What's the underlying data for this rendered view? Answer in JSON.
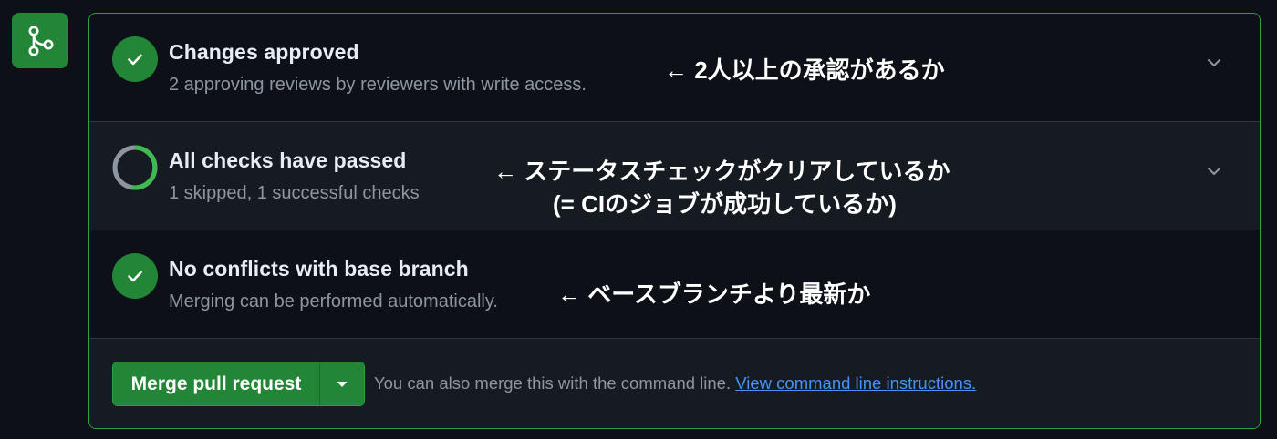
{
  "colors": {
    "background": "#0d1117",
    "success_green": "#238636",
    "border_green": "#2ea043",
    "link_blue": "#4493f8",
    "muted_text": "#8d96a0"
  },
  "merge_icon": {
    "icon": "git-merge-icon"
  },
  "sections": [
    {
      "title": "Changes approved",
      "subtitle": "2 approving reviews by reviewers with write access.",
      "status_icon": "check-circle-icon",
      "annotation_lines": [
        "← 2人以上の承認があるか"
      ]
    },
    {
      "title": "All checks have passed",
      "subtitle": "1 skipped, 1 successful checks",
      "status_icon": "checks-progress-ring-icon",
      "annotation_lines": [
        "← ステータスチェックがクリアしているか",
        "(= CIのジョブが成功しているか)"
      ]
    },
    {
      "title": "No conflicts with base branch",
      "subtitle": "Merging can be performed automatically.",
      "status_icon": "check-circle-icon",
      "annotation_lines": [
        "← ベースブランチより最新か"
      ]
    }
  ],
  "footer": {
    "merge_button_label": "Merge pull request",
    "dropdown_icon": "caret-down-icon",
    "info_text": "You can also merge this with the command line.",
    "link_text": "View command line instructions."
  }
}
